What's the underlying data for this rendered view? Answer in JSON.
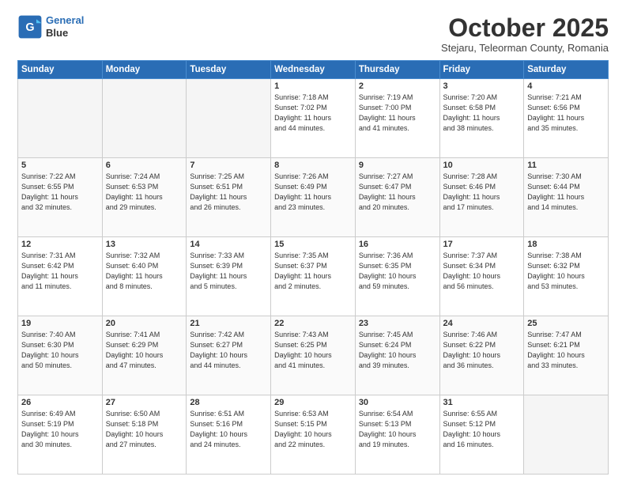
{
  "header": {
    "logo_line1": "General",
    "logo_line2": "Blue",
    "month_title": "October 2025",
    "location": "Stejaru, Teleorman County, Romania"
  },
  "weekdays": [
    "Sunday",
    "Monday",
    "Tuesday",
    "Wednesday",
    "Thursday",
    "Friday",
    "Saturday"
  ],
  "rows": [
    [
      {
        "day": "",
        "info": ""
      },
      {
        "day": "",
        "info": ""
      },
      {
        "day": "",
        "info": ""
      },
      {
        "day": "1",
        "info": "Sunrise: 7:18 AM\nSunset: 7:02 PM\nDaylight: 11 hours\nand 44 minutes."
      },
      {
        "day": "2",
        "info": "Sunrise: 7:19 AM\nSunset: 7:00 PM\nDaylight: 11 hours\nand 41 minutes."
      },
      {
        "day": "3",
        "info": "Sunrise: 7:20 AM\nSunset: 6:58 PM\nDaylight: 11 hours\nand 38 minutes."
      },
      {
        "day": "4",
        "info": "Sunrise: 7:21 AM\nSunset: 6:56 PM\nDaylight: 11 hours\nand 35 minutes."
      }
    ],
    [
      {
        "day": "5",
        "info": "Sunrise: 7:22 AM\nSunset: 6:55 PM\nDaylight: 11 hours\nand 32 minutes."
      },
      {
        "day": "6",
        "info": "Sunrise: 7:24 AM\nSunset: 6:53 PM\nDaylight: 11 hours\nand 29 minutes."
      },
      {
        "day": "7",
        "info": "Sunrise: 7:25 AM\nSunset: 6:51 PM\nDaylight: 11 hours\nand 26 minutes."
      },
      {
        "day": "8",
        "info": "Sunrise: 7:26 AM\nSunset: 6:49 PM\nDaylight: 11 hours\nand 23 minutes."
      },
      {
        "day": "9",
        "info": "Sunrise: 7:27 AM\nSunset: 6:47 PM\nDaylight: 11 hours\nand 20 minutes."
      },
      {
        "day": "10",
        "info": "Sunrise: 7:28 AM\nSunset: 6:46 PM\nDaylight: 11 hours\nand 17 minutes."
      },
      {
        "day": "11",
        "info": "Sunrise: 7:30 AM\nSunset: 6:44 PM\nDaylight: 11 hours\nand 14 minutes."
      }
    ],
    [
      {
        "day": "12",
        "info": "Sunrise: 7:31 AM\nSunset: 6:42 PM\nDaylight: 11 hours\nand 11 minutes."
      },
      {
        "day": "13",
        "info": "Sunrise: 7:32 AM\nSunset: 6:40 PM\nDaylight: 11 hours\nand 8 minutes."
      },
      {
        "day": "14",
        "info": "Sunrise: 7:33 AM\nSunset: 6:39 PM\nDaylight: 11 hours\nand 5 minutes."
      },
      {
        "day": "15",
        "info": "Sunrise: 7:35 AM\nSunset: 6:37 PM\nDaylight: 11 hours\nand 2 minutes."
      },
      {
        "day": "16",
        "info": "Sunrise: 7:36 AM\nSunset: 6:35 PM\nDaylight: 10 hours\nand 59 minutes."
      },
      {
        "day": "17",
        "info": "Sunrise: 7:37 AM\nSunset: 6:34 PM\nDaylight: 10 hours\nand 56 minutes."
      },
      {
        "day": "18",
        "info": "Sunrise: 7:38 AM\nSunset: 6:32 PM\nDaylight: 10 hours\nand 53 minutes."
      }
    ],
    [
      {
        "day": "19",
        "info": "Sunrise: 7:40 AM\nSunset: 6:30 PM\nDaylight: 10 hours\nand 50 minutes."
      },
      {
        "day": "20",
        "info": "Sunrise: 7:41 AM\nSunset: 6:29 PM\nDaylight: 10 hours\nand 47 minutes."
      },
      {
        "day": "21",
        "info": "Sunrise: 7:42 AM\nSunset: 6:27 PM\nDaylight: 10 hours\nand 44 minutes."
      },
      {
        "day": "22",
        "info": "Sunrise: 7:43 AM\nSunset: 6:25 PM\nDaylight: 10 hours\nand 41 minutes."
      },
      {
        "day": "23",
        "info": "Sunrise: 7:45 AM\nSunset: 6:24 PM\nDaylight: 10 hours\nand 39 minutes."
      },
      {
        "day": "24",
        "info": "Sunrise: 7:46 AM\nSunset: 6:22 PM\nDaylight: 10 hours\nand 36 minutes."
      },
      {
        "day": "25",
        "info": "Sunrise: 7:47 AM\nSunset: 6:21 PM\nDaylight: 10 hours\nand 33 minutes."
      }
    ],
    [
      {
        "day": "26",
        "info": "Sunrise: 6:49 AM\nSunset: 5:19 PM\nDaylight: 10 hours\nand 30 minutes."
      },
      {
        "day": "27",
        "info": "Sunrise: 6:50 AM\nSunset: 5:18 PM\nDaylight: 10 hours\nand 27 minutes."
      },
      {
        "day": "28",
        "info": "Sunrise: 6:51 AM\nSunset: 5:16 PM\nDaylight: 10 hours\nand 24 minutes."
      },
      {
        "day": "29",
        "info": "Sunrise: 6:53 AM\nSunset: 5:15 PM\nDaylight: 10 hours\nand 22 minutes."
      },
      {
        "day": "30",
        "info": "Sunrise: 6:54 AM\nSunset: 5:13 PM\nDaylight: 10 hours\nand 19 minutes."
      },
      {
        "day": "31",
        "info": "Sunrise: 6:55 AM\nSunset: 5:12 PM\nDaylight: 10 hours\nand 16 minutes."
      },
      {
        "day": "",
        "info": ""
      }
    ]
  ]
}
